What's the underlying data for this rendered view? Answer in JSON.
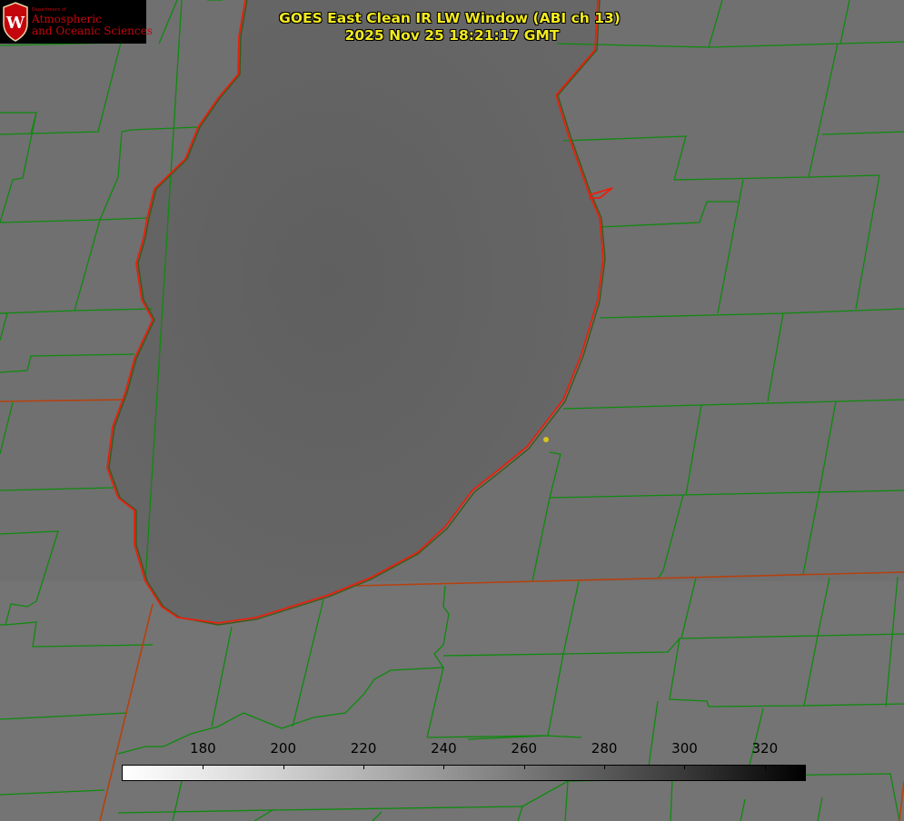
{
  "title": {
    "line1": "GOES East Clean IR LW Window (ABI ch 13)",
    "line2": "2025 Nov 25 18:21:17 GMT"
  },
  "logo": {
    "department": "Department of",
    "line1": "Atmospheric",
    "line2": "and Oceanic Sciences",
    "letter": "W"
  },
  "colorbar": {
    "min": 160,
    "max": 330,
    "ticks": [
      "180",
      "200",
      "220",
      "240",
      "260",
      "280",
      "300",
      "320"
    ],
    "from_color": "#ffffff",
    "to_color": "#000000"
  },
  "colors": {
    "background": "#6f6f6f",
    "county_lines": "#0e8a0e",
    "state_lines": "#b5410f",
    "lake_outline": "#e8200e",
    "station_dot": "#d8c21c",
    "title_text": "#f2ea1f",
    "logo_red": "#c5050c"
  }
}
